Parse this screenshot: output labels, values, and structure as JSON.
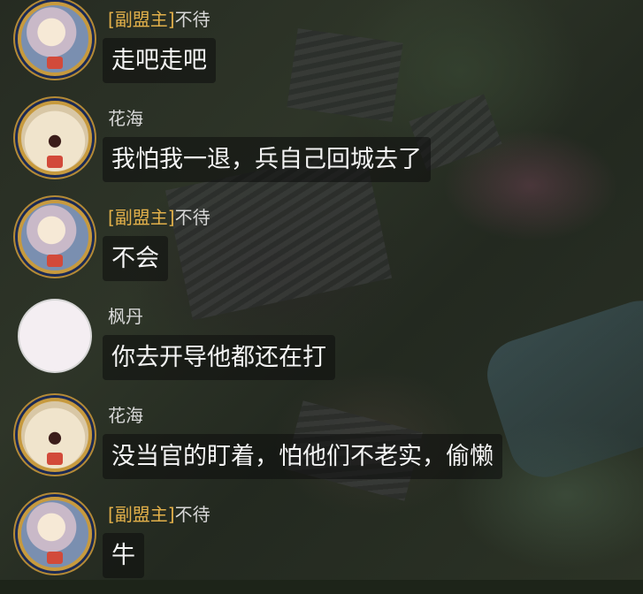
{
  "messages": [
    {
      "title": "[副盟主]",
      "name": "不待",
      "text": "走吧走吧",
      "avatar": "avatar-frame-gold-portrait"
    },
    {
      "title": "",
      "name": "花海",
      "text": "我怕我一退，兵自己回城去了",
      "avatar": "avatar-frame-gold-penguin"
    },
    {
      "title": "[副盟主]",
      "name": "不待",
      "text": "不会",
      "avatar": "avatar-frame-gold-portrait"
    },
    {
      "title": "",
      "name": "枫丹",
      "text": "你去开导他都还在打",
      "avatar": "avatar-anime-pink-hair"
    },
    {
      "title": "",
      "name": "花海",
      "text": "没当官的盯着，怕他们不老实，偷懒",
      "avatar": "avatar-frame-gold-penguin"
    },
    {
      "title": "[副盟主]",
      "name": "不待",
      "text": "牛",
      "avatar": "avatar-frame-gold-portrait"
    }
  ],
  "colors": {
    "title_tag": "#e2b04a",
    "name_text": "#d8d8d8",
    "bubble_bg": "rgba(12,12,12,0.55)",
    "bubble_text": "#f4f4f4"
  }
}
